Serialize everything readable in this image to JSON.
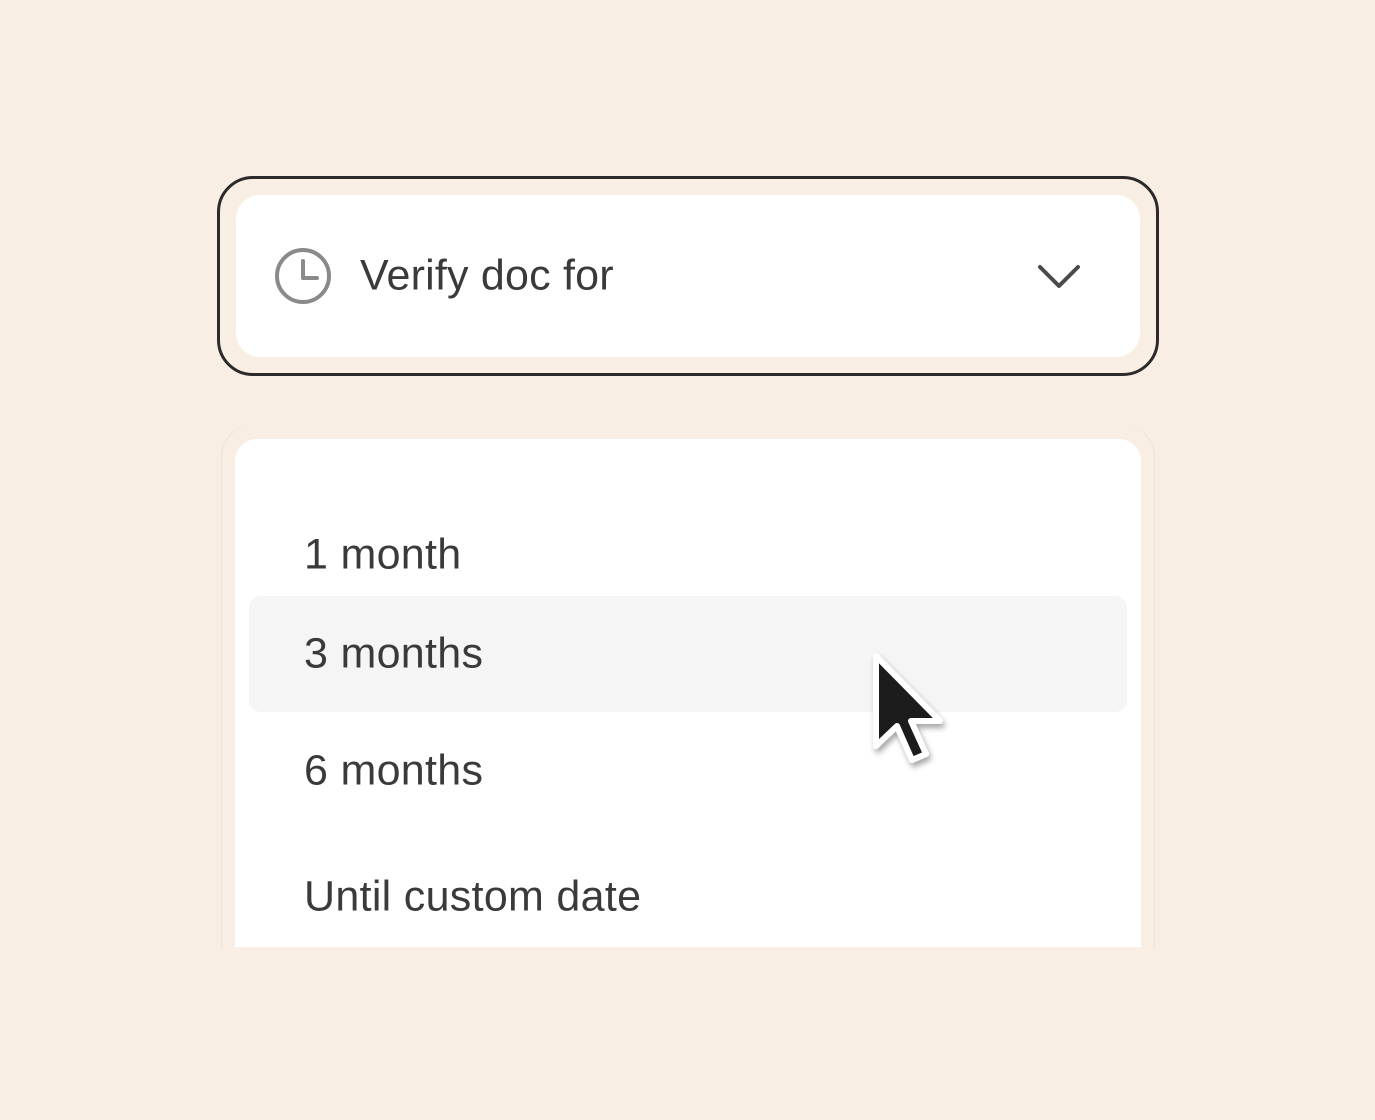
{
  "select": {
    "label": "Verify doc for",
    "leading_icon": "clock-icon",
    "trailing_icon": "chevron-down-icon",
    "expanded": true
  },
  "menu": {
    "items": [
      {
        "label": "1 month",
        "hovered": false
      },
      {
        "label": "3 months",
        "hovered": true
      },
      {
        "label": "6 months",
        "hovered": false
      },
      {
        "label": "Until custom date",
        "hovered": false
      }
    ]
  },
  "cursor": {
    "icon": "mouse-pointer-icon"
  },
  "colors": {
    "background": "#f8eee4",
    "surface": "#ffffff",
    "focus_border": "#2b2b2b",
    "text": "#3a3a3a",
    "icon": "#8a8a8a",
    "hover": "#f5f5f5"
  }
}
